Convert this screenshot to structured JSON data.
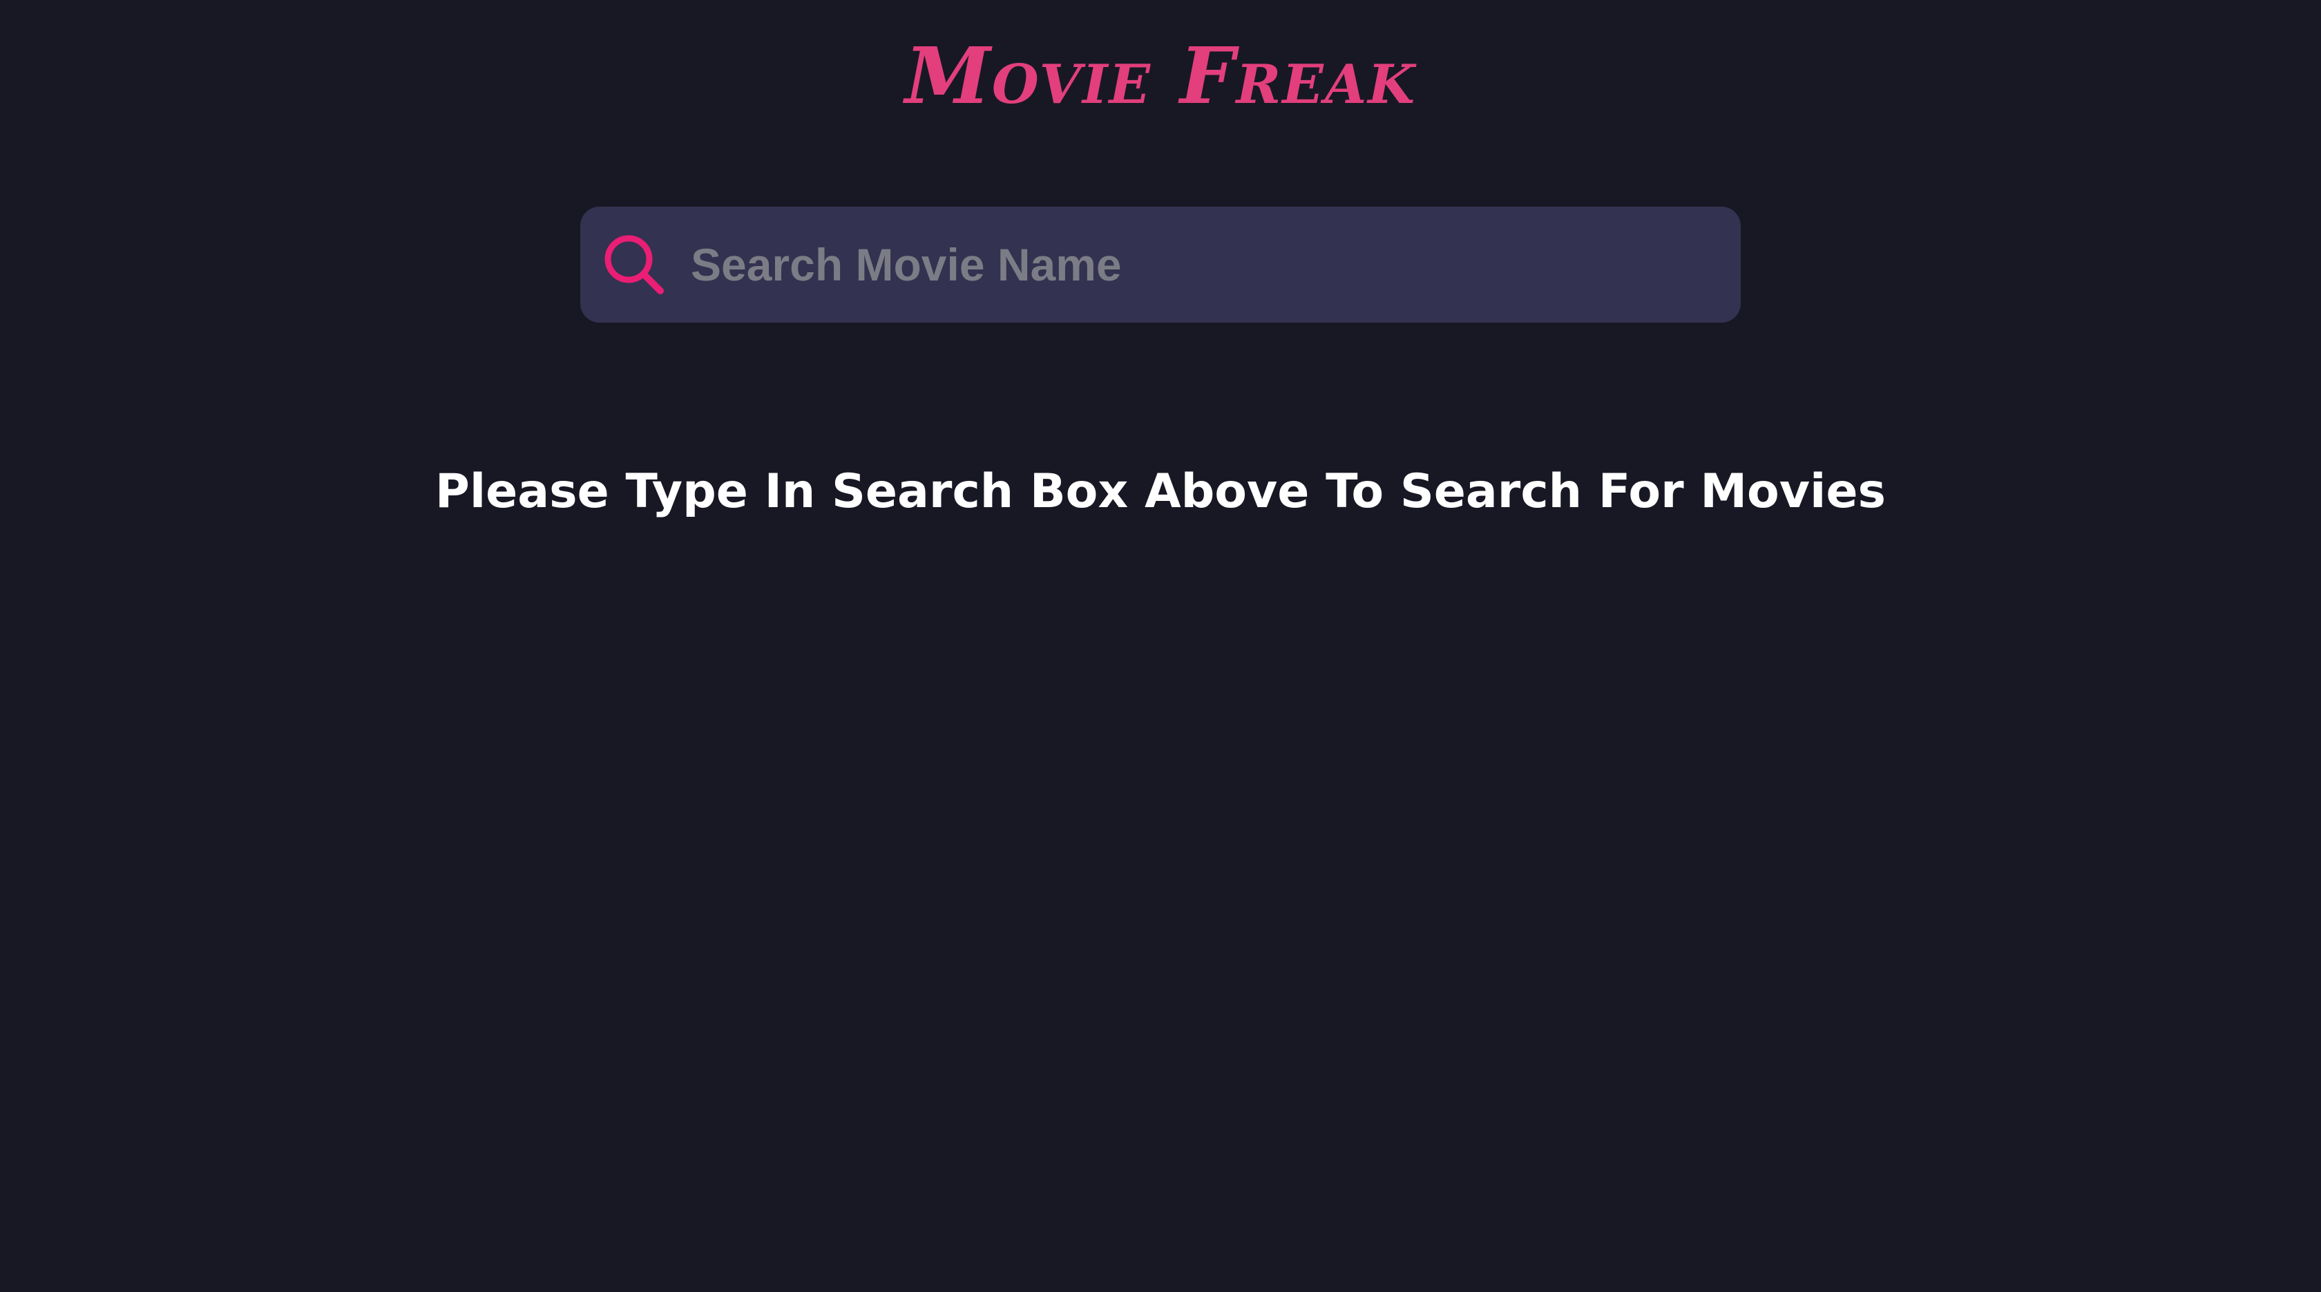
{
  "app": {
    "title": "Movie Freak"
  },
  "search": {
    "icon": "search-icon",
    "placeholder": "Search Movie Name",
    "value": ""
  },
  "main": {
    "message": "Please Type In Search Box Above To Search For Movies"
  },
  "colors": {
    "background": "#181825",
    "accent": "#e23f7c",
    "icon": "#e91e74",
    "search_bar": "#333250",
    "placeholder": "#7c7c86",
    "message_text": "#ffffff"
  }
}
